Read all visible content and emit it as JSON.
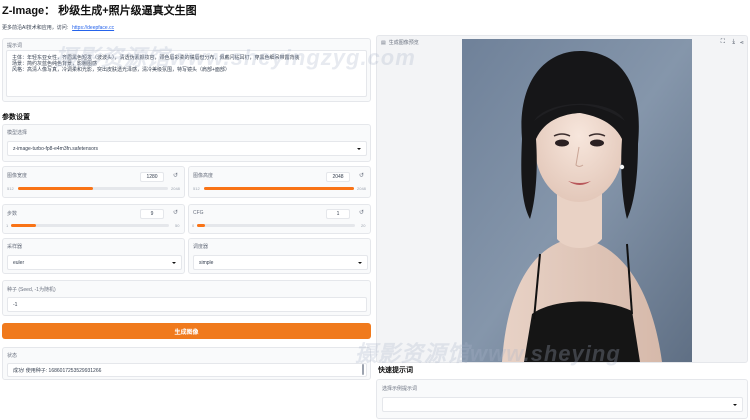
{
  "header": {
    "title": "Z-Image： 秒级生成+照片级逼真文生图",
    "subtitle": "更多前沿AI技术和应用，访问:",
    "link": "https://deepface.cc"
  },
  "prompt": {
    "label": "提示词",
    "lines": [
      "主体：年轻东亚女性，齐眉黑色短发（波波头），清透伪素颜妆容，颈色唇彩柔的嘴唇但分布，佩戴闪钻耳钉，穿黑色细吊带露背装",
      "场景：简约灰蓝色纯色背景，影棚图感",
      "风格：高清人像写真，冷调柔和光影，突出皮肤透光泽感，清冷美级氛围，特写镜头（肩部+面部）"
    ]
  },
  "params": {
    "section_title": "参数设置",
    "model_label": "模型选择",
    "model_value": "z-image-turbo-fp8-e4m3fn.safetensors",
    "width_label": "图像宽度",
    "width_value": "1280",
    "width_min": "512",
    "width_max": "2048",
    "width_fraction": 0.5,
    "height_label": "图像高度",
    "height_value": "2048",
    "height_min": "512",
    "height_max": "2048",
    "height_fraction": 1.0,
    "steps_label": "步数",
    "steps_value": "9",
    "steps_min": "1",
    "steps_max": "50",
    "steps_fraction": 0.16,
    "cfg_label": "CFG",
    "cfg_value": "1",
    "cfg_min": "0",
    "cfg_max": "20",
    "cfg_fraction": 0.05,
    "sampler_label": "采样器",
    "sampler_value": "euler",
    "scheduler_label": "调度器",
    "scheduler_value": "simple",
    "seed_label": "种子 (Seed, -1为随机)",
    "seed_value": "-1",
    "reset_glyph": "↺"
  },
  "generate_button": "生成图像",
  "status": {
    "label": "状态",
    "value": "成功! 使用种子: 1686017253529931266"
  },
  "image_panel": {
    "label": "生成图像预览"
  },
  "quick": {
    "title": "快速提示词",
    "select_label": "选择示例提示词",
    "select_value": ""
  },
  "watermark": {
    "text1": "摄影资源馆www.sheyingzyg.com",
    "text2": "摄影资源馆www.sheying"
  },
  "colors": {
    "accent": "#f07a1d",
    "slider_fill": "#f97316",
    "link": "#2563eb"
  }
}
